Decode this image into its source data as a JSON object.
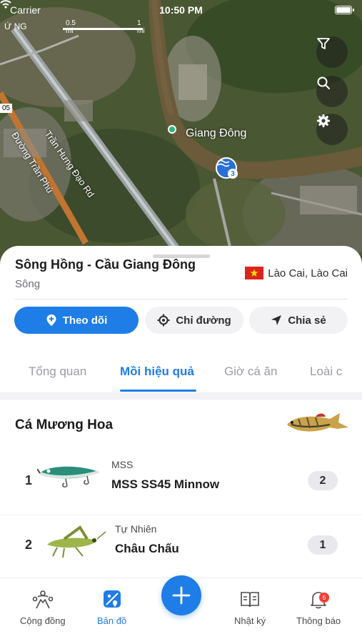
{
  "status_bar": {
    "carrier": "Carrier",
    "time": "10:50 PM"
  },
  "map": {
    "corner_label": "Ứ NG",
    "scale": {
      "label_half": "0.5 mi",
      "label_full": "1 mi"
    },
    "road_badge": "05",
    "place_label": "Giang Đông",
    "road_labels": [
      "Trần Hưng Đạo Rd",
      "Đường Trần Phú"
    ],
    "pin_count": "3",
    "controls": [
      "filter-icon",
      "search-icon",
      "gear-icon"
    ]
  },
  "sheet": {
    "title": "Sông Hồng - Cầu Giang Đông",
    "subtitle": "Sông",
    "location": "Lào Cai, Lào Cai",
    "actions": {
      "follow": "Theo dõi",
      "directions": "Chỉ đường",
      "share": "Chia sẻ"
    },
    "tabs": [
      "Tổng quan",
      "Mồi hiệu quả",
      "Giờ cá ăn",
      "Loài c"
    ],
    "active_tab": "Mồi hiệu quả",
    "species": "Cá Mương Hoa",
    "baits": [
      {
        "rank": "1",
        "brand": "MSS",
        "name": "MSS SS45 Minnow",
        "count": "2"
      },
      {
        "rank": "2",
        "brand": "Tự Nhiên",
        "name": "Châu Chấu",
        "count": "1"
      }
    ]
  },
  "tabbar": {
    "community": "Cộng đồng",
    "map": "Bản đồ",
    "journal": "Nhật ký",
    "notifications": "Thông báo",
    "notification_count": "6",
    "active": "Bản đồ"
  },
  "colors": {
    "accent": "#1e7de6",
    "badge": "#ff3b30",
    "flag": "#da251d"
  }
}
